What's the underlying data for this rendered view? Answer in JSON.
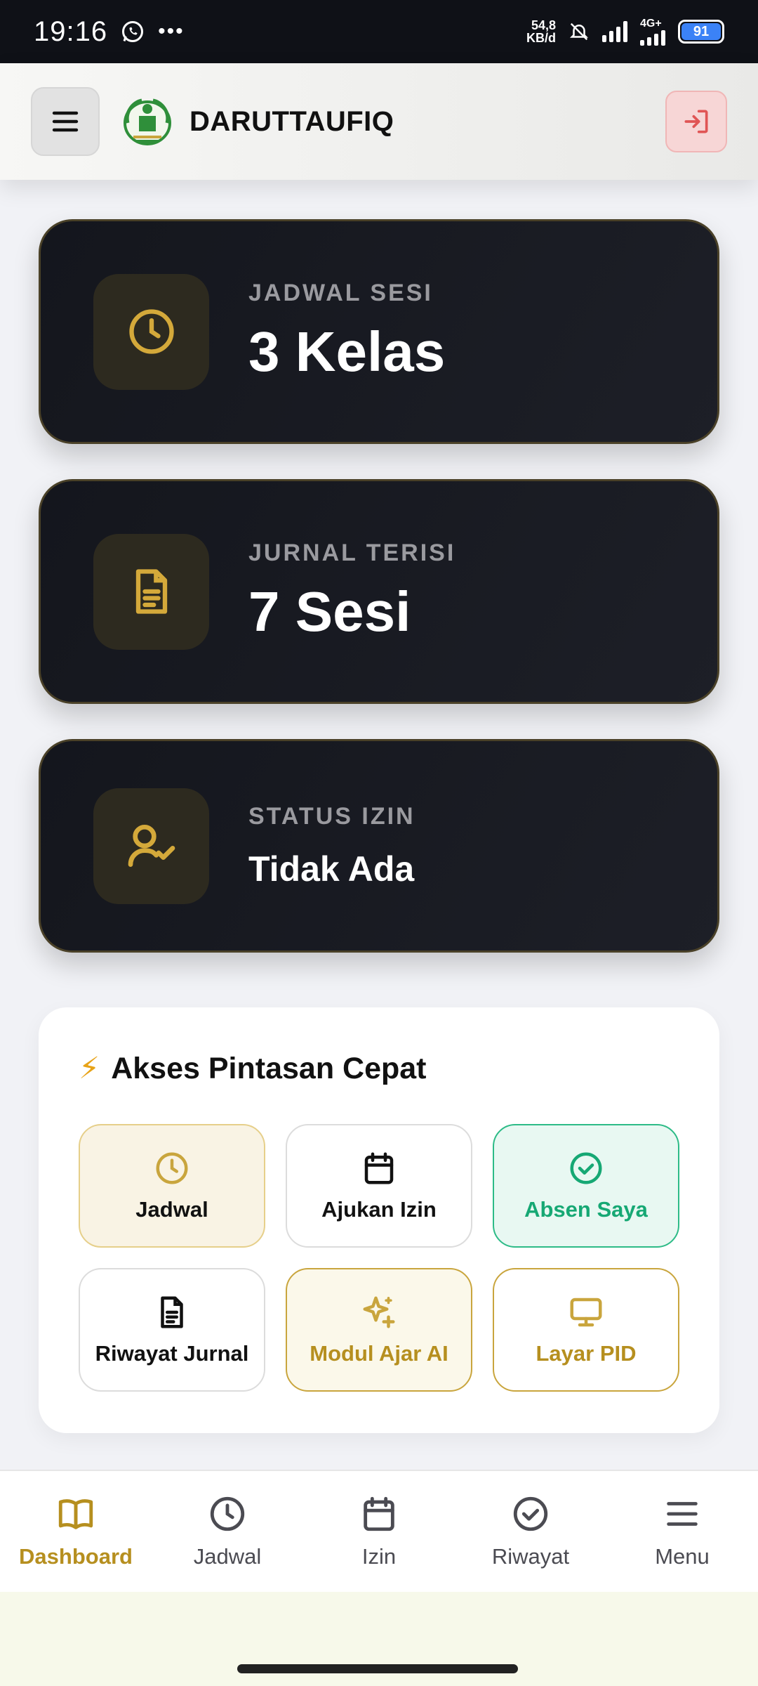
{
  "status_bar": {
    "time": "19:16",
    "speed_value": "54,8",
    "speed_unit": "KB/d",
    "network": "4G+",
    "battery": "91"
  },
  "header": {
    "brand": "DARUTTAUFIQ"
  },
  "stats": [
    {
      "label": "JADWAL SESI",
      "value": "3 Kelas",
      "icon": "clock-icon"
    },
    {
      "label": "JURNAL TERISI",
      "value": "7 Sesi",
      "icon": "document-icon"
    },
    {
      "label": "STATUS IZIN",
      "value": "Tidak Ada",
      "icon": "user-check-icon"
    }
  ],
  "quick_access": {
    "title": "Akses Pintasan Cepat",
    "title_emoji": "⚡",
    "tiles": [
      {
        "label": "Jadwal",
        "icon": "clock-icon"
      },
      {
        "label": "Ajukan Izin",
        "icon": "calendar-icon"
      },
      {
        "label": "Absen Saya",
        "icon": "check-circle-icon"
      },
      {
        "label": "Riwayat Jurnal",
        "icon": "document-icon"
      },
      {
        "label": "Modul Ajar AI",
        "icon": "sparkles-icon"
      },
      {
        "label": "Layar PID",
        "icon": "monitor-icon"
      }
    ]
  },
  "bottom_nav": [
    {
      "label": "Dashboard",
      "icon": "book-open-icon",
      "active": true
    },
    {
      "label": "Jadwal",
      "icon": "clock-icon",
      "active": false
    },
    {
      "label": "Izin",
      "icon": "calendar-icon",
      "active": false
    },
    {
      "label": "Riwayat",
      "icon": "check-circle-icon",
      "active": false
    },
    {
      "label": "Menu",
      "icon": "menu-icon",
      "active": false
    }
  ],
  "colors": {
    "accent_gold": "#c9a53d",
    "success_green": "#16a874",
    "logout_red": "#e05555",
    "card_dark": "#14161d"
  }
}
